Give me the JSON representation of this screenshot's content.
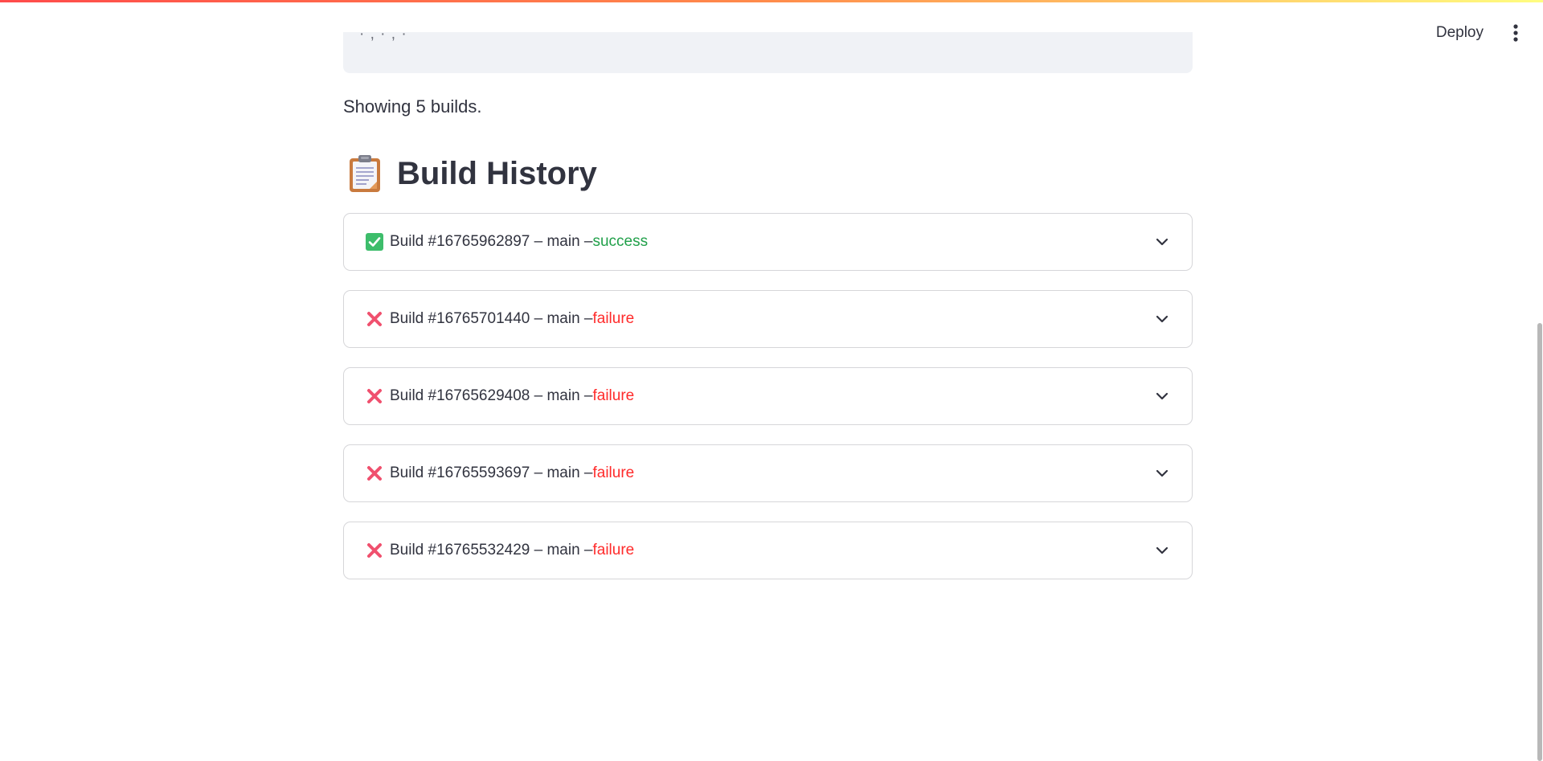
{
  "header": {
    "deploy_label": "Deploy"
  },
  "top_box": {
    "fragment": "· , · , ·"
  },
  "summary": {
    "showing_text": "Showing 5 builds."
  },
  "section": {
    "icon": "clipboard-icon",
    "title": "Build History"
  },
  "builds": [
    {
      "label": "Build #16765962897 – main – ",
      "status": "success",
      "icon": "check-icon"
    },
    {
      "label": "Build #16765701440 – main – ",
      "status": "failure",
      "icon": "cross-icon"
    },
    {
      "label": "Build #16765629408 – main – ",
      "status": "failure",
      "icon": "cross-icon"
    },
    {
      "label": "Build #16765593697 – main – ",
      "status": "failure",
      "icon": "cross-icon"
    },
    {
      "label": "Build #16765532429 – main – ",
      "status": "failure",
      "icon": "cross-icon"
    }
  ],
  "colors": {
    "success": "#21a04a",
    "failure": "#ff2b2b",
    "text": "#31333f",
    "border": "#d6d6d9"
  }
}
